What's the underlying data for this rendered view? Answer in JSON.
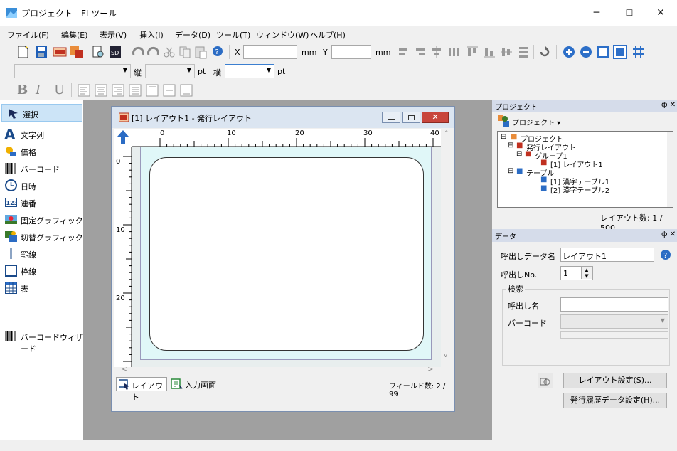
{
  "window": {
    "title": "プロジェクト - FI ツール",
    "minimize": "─",
    "maximize": "☐",
    "close": "✕"
  },
  "menu": [
    {
      "label": "ファイル(F)"
    },
    {
      "label": "編集(E)"
    },
    {
      "label": "表示(V)"
    },
    {
      "label": "挿入(I)"
    },
    {
      "label": "データ(D)"
    },
    {
      "label": "ツール(T)"
    },
    {
      "label": "ウィンドウ(W)"
    },
    {
      "label": "ヘルプ(H)"
    }
  ],
  "toolbar": {
    "x_label": "X",
    "x_unit": "mm",
    "y_label": "Y",
    "y_unit": "mm",
    "tate_label": "縦",
    "tate_unit": "pt",
    "yoko_label": "横",
    "yoko_unit": "pt",
    "bold": "B",
    "italic": "I",
    "underline": "U"
  },
  "tools": [
    {
      "label": "選択",
      "icon": "cursor-icon"
    },
    {
      "label": "文字列",
      "icon": "text-icon"
    },
    {
      "label": "価格",
      "icon": "price-icon"
    },
    {
      "label": "バーコード",
      "icon": "barcode-icon"
    },
    {
      "label": "日時",
      "icon": "clock-icon"
    },
    {
      "label": "連番",
      "icon": "sequence-icon"
    },
    {
      "label": "固定グラフィック",
      "icon": "fixed-graphic-icon"
    },
    {
      "label": "切替グラフィック",
      "icon": "switch-graphic-icon"
    },
    {
      "label": "罫線",
      "icon": "line-icon"
    },
    {
      "label": "枠線",
      "icon": "frame-icon"
    },
    {
      "label": "表",
      "icon": "table-icon"
    },
    {
      "label": "バーコードウィザード",
      "icon": "barcode-wizard-icon"
    }
  ],
  "document": {
    "title": "[1] レイアウト1 - 発行レイアウト",
    "ruler_h": [
      "0",
      "10",
      "20",
      "30",
      "40"
    ],
    "ruler_v": [
      "0",
      "10",
      "20"
    ],
    "tab_layout": "レイアウト",
    "tab_input": "入力画面",
    "field_count": "フィールド数: 2 / 99"
  },
  "project": {
    "panel_title": "プロジェクト",
    "dropdown": "プロジェクト ▾",
    "tree": [
      {
        "label": "プロジェクト"
      },
      {
        "label": "発行レイアウト"
      },
      {
        "label": "グループ1"
      },
      {
        "label": "[1] レイアウト1"
      },
      {
        "label": "テーブル"
      },
      {
        "label": "[1] 漢字テーブル1"
      },
      {
        "label": "[2] 漢字テーブル2"
      }
    ],
    "layout_count": "レイアウト数: 1 / 500"
  },
  "data_panel": {
    "title": "データ",
    "call_name_label": "呼出しデータ名",
    "call_name_value": "レイアウト1",
    "call_no_label": "呼出しNo.",
    "call_no_value": "1",
    "search_label": "検索",
    "search_name_label": "呼出し名",
    "barcode_label": "バーコード",
    "layout_settings_button": "レイアウト設定(S)...",
    "history_button": "発行履歴データ設定(H)..."
  }
}
